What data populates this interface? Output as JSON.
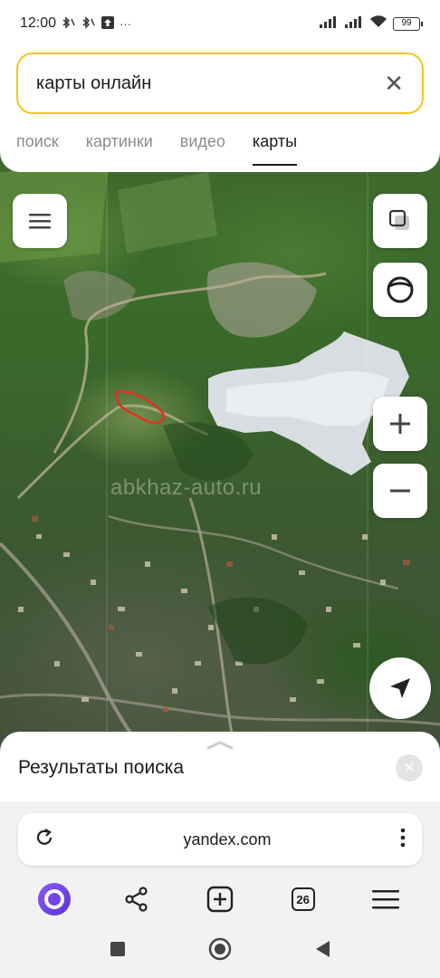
{
  "status_bar": {
    "time": "12:00",
    "left_icons": [
      "bluetooth-icon",
      "bluetooth-icon",
      "upload-notification-icon",
      "more-dots-icon"
    ],
    "battery": "99"
  },
  "search": {
    "query": "карты онлайн",
    "clear_icon": "close-icon",
    "accent_color": "#f5c518"
  },
  "tabs": [
    {
      "label": "поиск",
      "active": false
    },
    {
      "label": "картинки",
      "active": false
    },
    {
      "label": "видео",
      "active": false
    },
    {
      "label": "карты",
      "active": true
    }
  ],
  "map": {
    "watermark": "abkhaz-auto.ru",
    "controls": [
      "menu-icon",
      "layers-icon",
      "camera-icon",
      "zoom-in-icon",
      "zoom-out-icon",
      "navigate-icon"
    ]
  },
  "results": {
    "title": "Результаты поиска"
  },
  "browser": {
    "url": "yandex.com",
    "tabs_count": "26",
    "toolbar": [
      "alice-icon",
      "share-icon",
      "new-tab-icon",
      "tabs-icon",
      "menu-icon"
    ]
  },
  "system_nav": [
    "recents-icon",
    "home-icon",
    "back-icon"
  ]
}
